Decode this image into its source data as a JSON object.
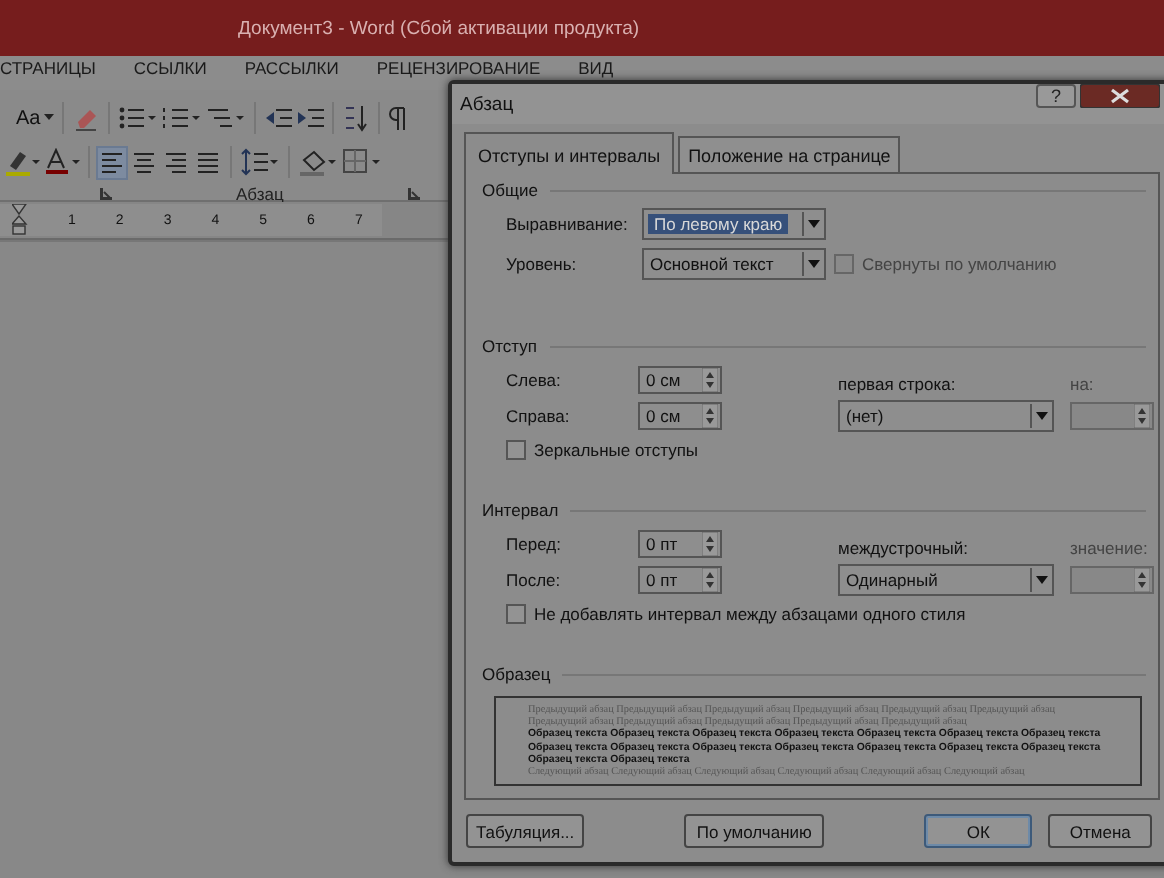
{
  "app_title": "Документ3 -  Word (Сбой активации продукта)",
  "ribbon_tabs": [
    "СТРАНИЦЫ",
    "ССЫЛКИ",
    "РАССЫЛКИ",
    "РЕЦЕНЗИРОВАНИЕ",
    "ВИД"
  ],
  "ribbon": {
    "font_case": "Aa",
    "group_label": "Абзац",
    "align_buttons": [
      {
        "kind": "left",
        "selected": true
      },
      {
        "kind": "center",
        "selected": false
      },
      {
        "kind": "right",
        "selected": false
      },
      {
        "kind": "justify",
        "selected": false
      }
    ]
  },
  "ruler": [
    "1",
    "2",
    "3",
    "4",
    "5",
    "6",
    "7"
  ],
  "dialog": {
    "title": "Абзац",
    "help": "?",
    "tabs": [
      {
        "label": "Отступы и интервалы",
        "selected": true
      },
      {
        "label": "Положение на странице",
        "selected": false
      }
    ],
    "general": {
      "heading": "Общие",
      "alignment": {
        "label": "Выравнивание:",
        "value": "По левому краю",
        "highlighted": true
      },
      "level": {
        "label": "Уровень:",
        "value": "Основной текст"
      },
      "collapsed": {
        "label": "Свернуты по умолчанию",
        "checked": false,
        "disabled": true
      }
    },
    "indent": {
      "heading": "Отступ",
      "left": {
        "label": "Слева:",
        "value": "0 см"
      },
      "right": {
        "label": "Справа:",
        "value": "0 см"
      },
      "first_line": {
        "label": "первая строка:",
        "value": "(нет)"
      },
      "by": {
        "label": "на:",
        "disabled": true
      },
      "mirror": {
        "label": "Зеркальные отступы",
        "checked": false
      }
    },
    "spacing": {
      "heading": "Интервал",
      "before": {
        "label": "Перед:",
        "value": "0 пт"
      },
      "after": {
        "label": "После:",
        "value": "0 пт"
      },
      "line": {
        "label": "междустрочный:",
        "value": "Одинарный"
      },
      "at": {
        "label": "значение:",
        "disabled": true
      },
      "no_space": {
        "label": "Не добавлять интервал между абзацами одного стиля",
        "checked": false
      }
    },
    "preview": {
      "heading": "Образец",
      "previous": "Предыдущий абзац Предыдущий абзац Предыдущий абзац Предыдущий абзац Предыдущий абзац Предыдущий абзац Предыдущий абзац Предыдущий абзац Предыдущий абзац Предыдущий абзац Предыдущий абзац",
      "sample": "Образец текста Образец текста Образец текста Образец текста Образец текста Образец текста Образец текста Образец текста Образец текста Образец текста Образец текста Образец текста Образец текста Образец текста Образец текста Образец текста",
      "next": "Следующий абзац Следующий абзац Следующий абзац Следующий абзац Следующий абзац Следующий абзац"
    },
    "buttons": [
      {
        "label": "Табуляция...",
        "kind": "normal"
      },
      {
        "label": "По умолчанию",
        "kind": "normal"
      },
      {
        "label": "ОК",
        "kind": "default"
      },
      {
        "label": "Отмена",
        "kind": "normal"
      }
    ]
  }
}
